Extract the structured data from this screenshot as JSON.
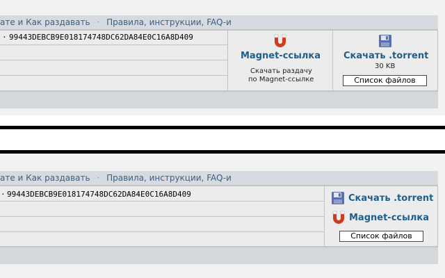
{
  "top": {
    "header": {
      "link_partial": "ате и Как раздавать",
      "separator": "·",
      "link_rules": "Правила, инструкции, FAQ-и"
    },
    "hash_prefix": "·",
    "hash": "99443DEBCB9E018174748DC62DA84E0C16A8D409",
    "magnet": {
      "icon": "magnet-icon",
      "label": "Magnet-ссылка",
      "desc_line1": "Скачать раздачу",
      "desc_line2": "по Magnet-ссылке"
    },
    "torrent": {
      "icon": "floppy-disk-icon",
      "label": "Скачать .torrent",
      "size": "30 KB",
      "files_button": "Список файлов"
    }
  },
  "bottom": {
    "header": {
      "link_partial": "ате и Как раздавать",
      "separator": "·",
      "link_rules": "Правила, инструкции, FAQ-и"
    },
    "hash_prefix": "·",
    "hash": "99443DEBCB9E018174748DC62DA84E0C16A8D409",
    "torrent": {
      "icon": "floppy-disk-icon",
      "label": "Скачать .torrent"
    },
    "magnet": {
      "icon": "magnet-icon",
      "label": "Magnet-ссылка"
    },
    "files_button": "Список файлов"
  },
  "colors": {
    "link": "#1d5f8c",
    "header_link": "#3b5f86",
    "magnet_red": "#d23a1e",
    "floppy_blue": "#5b6fae"
  }
}
